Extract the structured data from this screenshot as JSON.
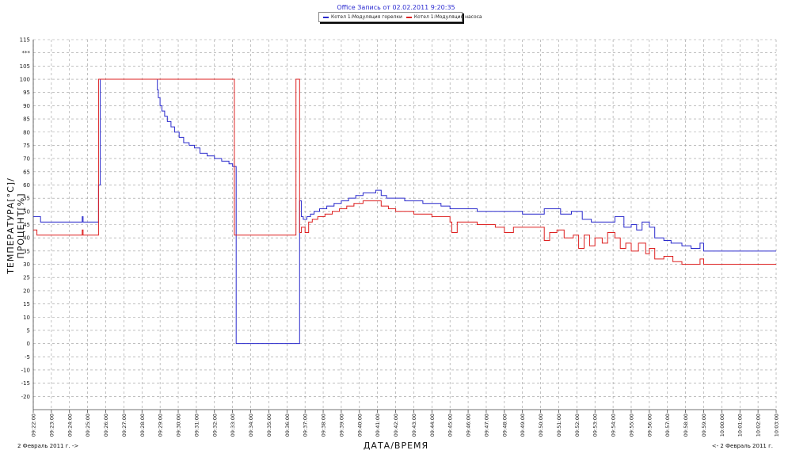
{
  "chart_data": {
    "type": "line",
    "title": "Office Запись от 02.02.2011 9:20:35",
    "ylabel": "ТЕМПЕРАТУРА[°C]/ПРОЦЕНТ[%]",
    "xlabel": "ДАТА/ВРЕМЯ",
    "date_left": "2 Февраль 2011 г. ->",
    "date_right": "<- 2 Февраль 2011 г.",
    "ylim": [
      -25,
      115
    ],
    "yticks": [
      -20,
      -15,
      -10,
      -5,
      0,
      5,
      10,
      15,
      20,
      25,
      30,
      35,
      40,
      45,
      50,
      55,
      60,
      65,
      70,
      75,
      80,
      85,
      90,
      95,
      100,
      105,
      110,
      115
    ],
    "ytick_overflow_label": "***",
    "xlim_minutes": [
      22,
      63
    ],
    "xticks": [
      "09:22:00",
      "09:23:00",
      "09:24:00",
      "09:25:00",
      "09:26:00",
      "09:27:00",
      "09:28:00",
      "09:29:00",
      "09:30:00",
      "09:31:00",
      "09:32:00",
      "09:33:00",
      "09:34:00",
      "09:35:00",
      "09:36:00",
      "09:37:00",
      "09:38:00",
      "09:39:00",
      "09:40:00",
      "09:41:00",
      "09:42:00",
      "09:43:00",
      "09:44:00",
      "09:45:00",
      "09:46:00",
      "09:47:00",
      "09:48:00",
      "09:49:00",
      "09:50:00",
      "09:51:00",
      "09:52:00",
      "09:53:00",
      "09:54:00",
      "09:55:00",
      "09:56:00",
      "09:57:00",
      "09:58:00",
      "09:59:00",
      "10:00:00",
      "10:01:00",
      "10:02:00",
      "10:03:00"
    ],
    "grid": true,
    "series": [
      {
        "name": "Котел 1:Модуляция горелки",
        "color": "#2a2acc",
        "points": [
          [
            22.0,
            48
          ],
          [
            22.4,
            48
          ],
          [
            22.4,
            46
          ],
          [
            24.7,
            46
          ],
          [
            24.7,
            48
          ],
          [
            24.75,
            48
          ],
          [
            24.75,
            46
          ],
          [
            25.6,
            46
          ],
          [
            25.6,
            60
          ],
          [
            25.7,
            60
          ],
          [
            25.7,
            100
          ],
          [
            28.8,
            100
          ],
          [
            28.85,
            96
          ],
          [
            28.9,
            93
          ],
          [
            29.0,
            90
          ],
          [
            29.1,
            88
          ],
          [
            29.25,
            86
          ],
          [
            29.4,
            84
          ],
          [
            29.6,
            82
          ],
          [
            29.8,
            80
          ],
          [
            30.05,
            78
          ],
          [
            30.3,
            76
          ],
          [
            30.6,
            75
          ],
          [
            30.9,
            74
          ],
          [
            31.2,
            72
          ],
          [
            31.6,
            71
          ],
          [
            32.0,
            70
          ],
          [
            32.4,
            69
          ],
          [
            32.8,
            68
          ],
          [
            33.0,
            67
          ],
          [
            33.2,
            67
          ],
          [
            33.2,
            0
          ],
          [
            36.7,
            0
          ],
          [
            36.7,
            54
          ],
          [
            36.8,
            48
          ],
          [
            36.9,
            47
          ],
          [
            37.1,
            48
          ],
          [
            37.3,
            49
          ],
          [
            37.5,
            50
          ],
          [
            37.8,
            51
          ],
          [
            38.2,
            52
          ],
          [
            38.6,
            53
          ],
          [
            39.0,
            54
          ],
          [
            39.4,
            55
          ],
          [
            39.8,
            56
          ],
          [
            40.2,
            57
          ],
          [
            40.6,
            57
          ],
          [
            40.9,
            58
          ],
          [
            41.2,
            56
          ],
          [
            41.5,
            55
          ],
          [
            42.0,
            55
          ],
          [
            42.5,
            54
          ],
          [
            43.5,
            53
          ],
          [
            44.5,
            52
          ],
          [
            45.0,
            51
          ],
          [
            46.5,
            50
          ],
          [
            48.0,
            50
          ],
          [
            49.0,
            49
          ],
          [
            50.2,
            49
          ],
          [
            50.2,
            51
          ],
          [
            50.7,
            51
          ],
          [
            51.1,
            49
          ],
          [
            51.7,
            50
          ],
          [
            52.3,
            47
          ],
          [
            52.8,
            46
          ],
          [
            53.5,
            46
          ],
          [
            54.1,
            48
          ],
          [
            54.6,
            44
          ],
          [
            55.0,
            45
          ],
          [
            55.3,
            43
          ],
          [
            55.6,
            46
          ],
          [
            56.0,
            44
          ],
          [
            56.3,
            40
          ],
          [
            56.8,
            39
          ],
          [
            57.2,
            38
          ],
          [
            57.8,
            37
          ],
          [
            58.3,
            36
          ],
          [
            58.8,
            38
          ],
          [
            59.0,
            35
          ],
          [
            63.0,
            35
          ]
        ]
      },
      {
        "name": "Котел 1:Модуляция насоса",
        "color": "#dd2020",
        "points": [
          [
            22.0,
            43
          ],
          [
            22.2,
            43
          ],
          [
            22.2,
            41
          ],
          [
            24.7,
            41
          ],
          [
            24.7,
            43
          ],
          [
            24.75,
            43
          ],
          [
            24.75,
            41
          ],
          [
            25.6,
            41
          ],
          [
            25.6,
            100
          ],
          [
            33.1,
            100
          ],
          [
            33.1,
            41
          ],
          [
            36.5,
            41
          ],
          [
            36.5,
            100
          ],
          [
            36.7,
            100
          ],
          [
            36.7,
            42
          ],
          [
            36.8,
            44
          ],
          [
            37.0,
            42
          ],
          [
            37.2,
            46
          ],
          [
            37.4,
            47
          ],
          [
            37.7,
            48
          ],
          [
            38.1,
            49
          ],
          [
            38.5,
            50
          ],
          [
            38.9,
            51
          ],
          [
            39.3,
            52
          ],
          [
            39.7,
            53
          ],
          [
            40.2,
            54
          ],
          [
            40.6,
            54
          ],
          [
            40.9,
            54
          ],
          [
            41.2,
            52
          ],
          [
            41.6,
            51
          ],
          [
            42.0,
            50
          ],
          [
            43.0,
            49
          ],
          [
            44.0,
            48
          ],
          [
            45.0,
            46
          ],
          [
            45.1,
            42
          ],
          [
            45.4,
            46
          ],
          [
            46.5,
            45
          ],
          [
            47.5,
            44
          ],
          [
            48.0,
            42
          ],
          [
            48.5,
            44
          ],
          [
            50.0,
            44
          ],
          [
            50.2,
            39
          ],
          [
            50.5,
            42
          ],
          [
            50.9,
            43
          ],
          [
            51.3,
            40
          ],
          [
            51.8,
            41
          ],
          [
            52.1,
            36
          ],
          [
            52.4,
            41
          ],
          [
            52.7,
            37
          ],
          [
            53.0,
            40
          ],
          [
            53.4,
            38
          ],
          [
            53.7,
            42
          ],
          [
            54.1,
            40
          ],
          [
            54.4,
            36
          ],
          [
            54.7,
            38
          ],
          [
            55.0,
            35
          ],
          [
            55.4,
            38
          ],
          [
            55.8,
            34
          ],
          [
            56.0,
            36
          ],
          [
            56.3,
            32
          ],
          [
            56.8,
            33
          ],
          [
            57.3,
            31
          ],
          [
            57.8,
            30
          ],
          [
            58.3,
            30
          ],
          [
            58.8,
            32
          ],
          [
            59.0,
            30
          ],
          [
            63.0,
            30
          ]
        ]
      }
    ]
  }
}
